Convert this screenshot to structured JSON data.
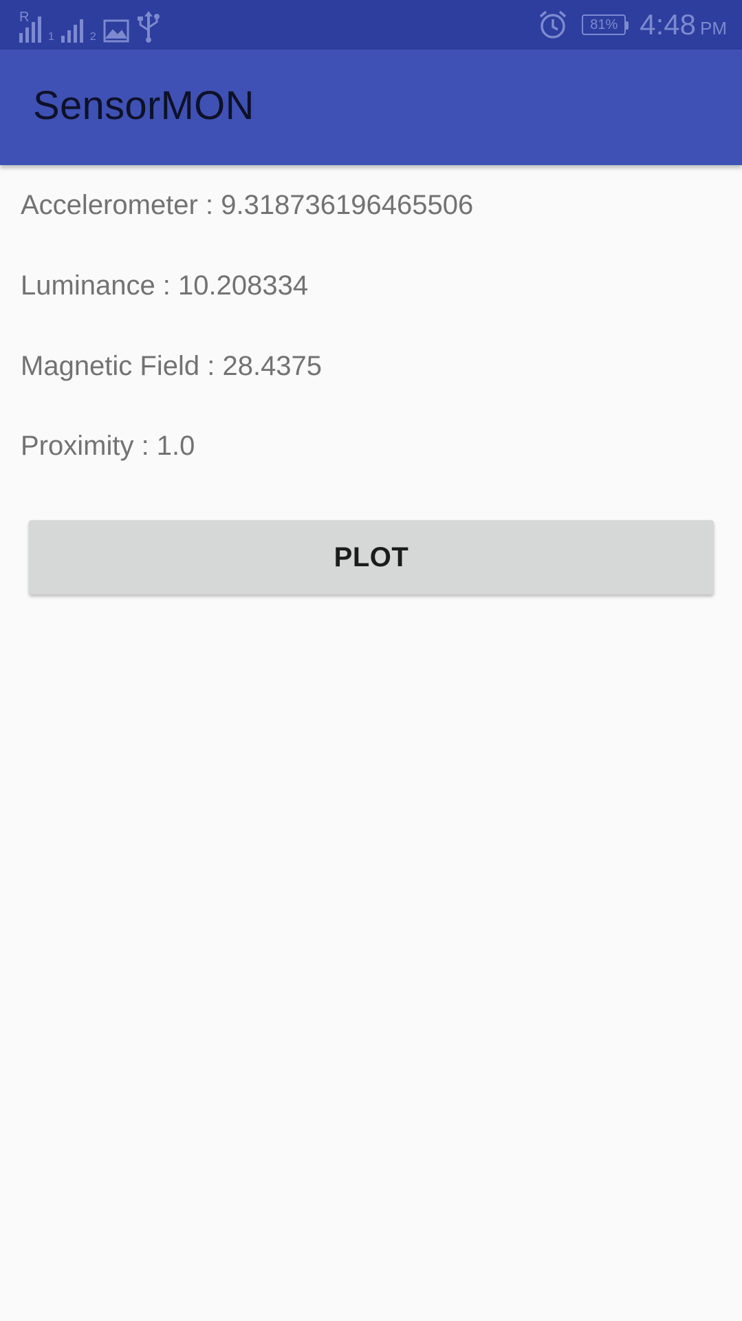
{
  "status_bar": {
    "sim1_indicator": "1",
    "sim2_indicator": "2",
    "roaming_indicator": "R",
    "battery_percent": "81%",
    "time": "4:48",
    "ampm": "PM",
    "icons": [
      "signal-icon",
      "signal-icon",
      "image-icon",
      "usb-icon",
      "alarm-icon",
      "battery-icon"
    ]
  },
  "app_bar": {
    "title": "SensorMON"
  },
  "readings": [
    {
      "text": "Accelerometer : 9.318736196465506"
    },
    {
      "text": "Luminance : 10.208334"
    },
    {
      "text": "Magnetic Field : 28.4375"
    },
    {
      "text": "Proximity : 1.0"
    }
  ],
  "actions": {
    "plot_label": "PLOT"
  },
  "colors": {
    "status_bar": "#2d3e9e",
    "app_bar": "#3f51b5",
    "background": "#fafafa",
    "button": "#d6d7d7"
  }
}
